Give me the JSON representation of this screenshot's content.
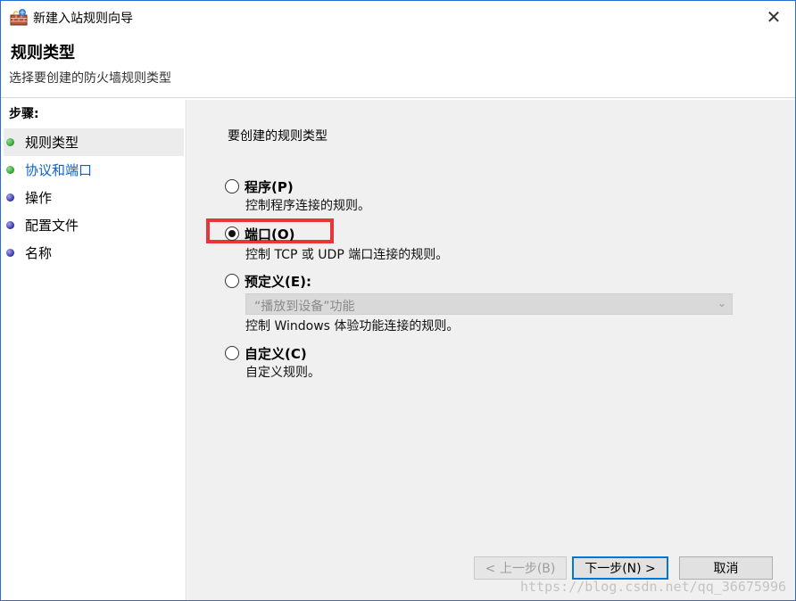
{
  "window": {
    "title": "新建入站规则向导",
    "close_glyph": "✕"
  },
  "header": {
    "title": "规则类型",
    "subtitle": "选择要创建的防火墙规则类型"
  },
  "sidebar": {
    "steps_title": "步骤:",
    "items": [
      {
        "label": "规则类型",
        "status": "done"
      },
      {
        "label": "协议和端口",
        "status": "current-link"
      },
      {
        "label": "操作",
        "status": "pending"
      },
      {
        "label": "配置文件",
        "status": "pending"
      },
      {
        "label": "名称",
        "status": "pending"
      }
    ]
  },
  "main": {
    "heading": "要创建的规则类型",
    "options": [
      {
        "label": "程序(P)",
        "description": "控制程序连接的规则。",
        "checked": false
      },
      {
        "label": "端口(O)",
        "description": "控制 TCP 或 UDP 端口连接的规则。",
        "checked": true
      },
      {
        "label": "预定义(E):",
        "description": "控制 Windows 体验功能连接的规则。",
        "checked": false
      },
      {
        "label": "自定义(C)",
        "description": "自定义规则。",
        "checked": false
      }
    ],
    "predefined_dropdown": {
      "value": "“播放到设备”功能",
      "enabled": false
    }
  },
  "buttons": {
    "back": "< 上一步(B)",
    "next": "下一步(N) >",
    "cancel": "取消"
  },
  "watermark": "https://blog.csdn.net/qq_36675996",
  "colors": {
    "highlight": "#e8353a",
    "link": "#0b62c6",
    "window_border": "#2a6ccf"
  }
}
